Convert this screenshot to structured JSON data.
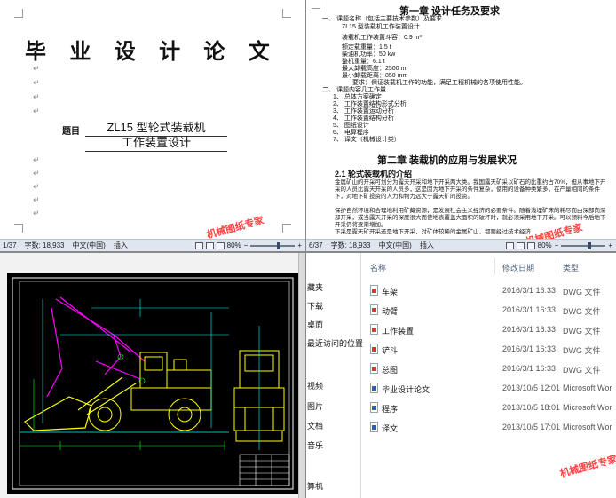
{
  "doc1": {
    "title": "毕 业 设 计 论 文",
    "topic_label": "题目",
    "topic_line1": "ZL15 型轮式装载机",
    "topic_line2": "工作装置设计",
    "status": {
      "page": "1/37",
      "words": "字数: 18,933",
      "lang": "中文(中国)",
      "mode": "插入",
      "zoom": "80%"
    }
  },
  "doc2": {
    "chapter1": "第一章   设计任务及要求",
    "items": [
      "一、    课题名称（包括主要技术参数）及要求",
      "ZL15 型装载机工作装置设计",
      "装载机工作装置斗容：0.9 m³",
      "额定载重量：1.5 t",
      "柴油机功率：50 kw",
      "整机重量：6.1 t",
      "最大卸载高度：2500 m",
      "最小卸载距离：850 mm",
      "要求：保证装载机工作的功能，满足工程机械的各项使用性能。",
      "二、    课题内容几工作量",
      "1、   总体方案确定",
      "2、   工作装置结构形式分析",
      "3、   工作装置运动分析",
      "4、   工作装置结构分析",
      "5、   图纸设计",
      "6、   电算程序",
      "7、   译文（机械设计类）"
    ],
    "chapter2": "第二章   装载机的应用与发展状况",
    "section": "2.1   轮式装载机的介绍",
    "body": [
      "金属矿山的开采可划分为露天开采和地下开采两大类。我国露天矿采以矿石的比重约占70%，但从事地下开采的人员比露天开采的人员多，这是因为地下开采的条件复杂，使用的设备种类繁多，在产量相同的条件下，对地下矿投资的人力和物力远大于露天矿的投资。",
      "保护自然环境和合理地利用矿藏资源，是发展社会主义经济的必要条件。随着浅埋矿床的耗尽而由深部向深部开采，或当露天开采的深度很大而使地表覆盖大面积的破坏时，就必须采用地下开采。可以预料今后地下开采仍将逐渐增加。",
      "下采是露天矿开采还是地下开采，对矿体较稀的金属矿山，都要经过技术经济"
    ],
    "status": {
      "page": "6/37",
      "words": "字数: 18,933",
      "lang": "中文(中国)",
      "mode": "插入",
      "zoom": "80%"
    }
  },
  "watermark": "机械图纸专家",
  "files": {
    "nav": [
      "藏夹",
      "下载",
      "桌面",
      "最近访问的位置",
      "视频",
      "图片",
      "文档",
      "音乐",
      "算机"
    ],
    "headers": {
      "name": "名称",
      "date": "修改日期",
      "type": "类型"
    },
    "rows": [
      {
        "name": "车架",
        "date": "2016/3/1 16:33",
        "type": "DWG 文件",
        "icon": "dwg-icon"
      },
      {
        "name": "动臂",
        "date": "2016/3/1 16:33",
        "type": "DWG 文件",
        "icon": "dwg-icon"
      },
      {
        "name": "工作装置",
        "date": "2016/3/1 16:33",
        "type": "DWG 文件",
        "icon": "dwg-icon"
      },
      {
        "name": "铲斗",
        "date": "2016/3/1 16:33",
        "type": "DWG 文件",
        "icon": "dwg-icon"
      },
      {
        "name": "总图",
        "date": "2016/3/1 16:33",
        "type": "DWG 文件",
        "icon": "dwg-icon"
      },
      {
        "name": "毕业设计论文",
        "date": "2013/10/5 12:01",
        "type": "Microsoft Wor",
        "icon": "word-doc-icon"
      },
      {
        "name": "程序",
        "date": "2013/10/5 18:01",
        "type": "Microsoft Wor",
        "icon": "word-doc-icon"
      },
      {
        "name": "译文",
        "date": "2013/10/5 17:01",
        "type": "Microsoft Wor",
        "icon": "word-doc-icon"
      }
    ]
  },
  "colors": {
    "watermark": "#ff2222",
    "cad_bg": "#000000",
    "cad_magenta": "#ff00ff",
    "cad_yellow": "#ffff00",
    "cad_green": "#00ff00",
    "cad_cyan": "#00ffff",
    "statusbar": "#dfe6ef"
  }
}
